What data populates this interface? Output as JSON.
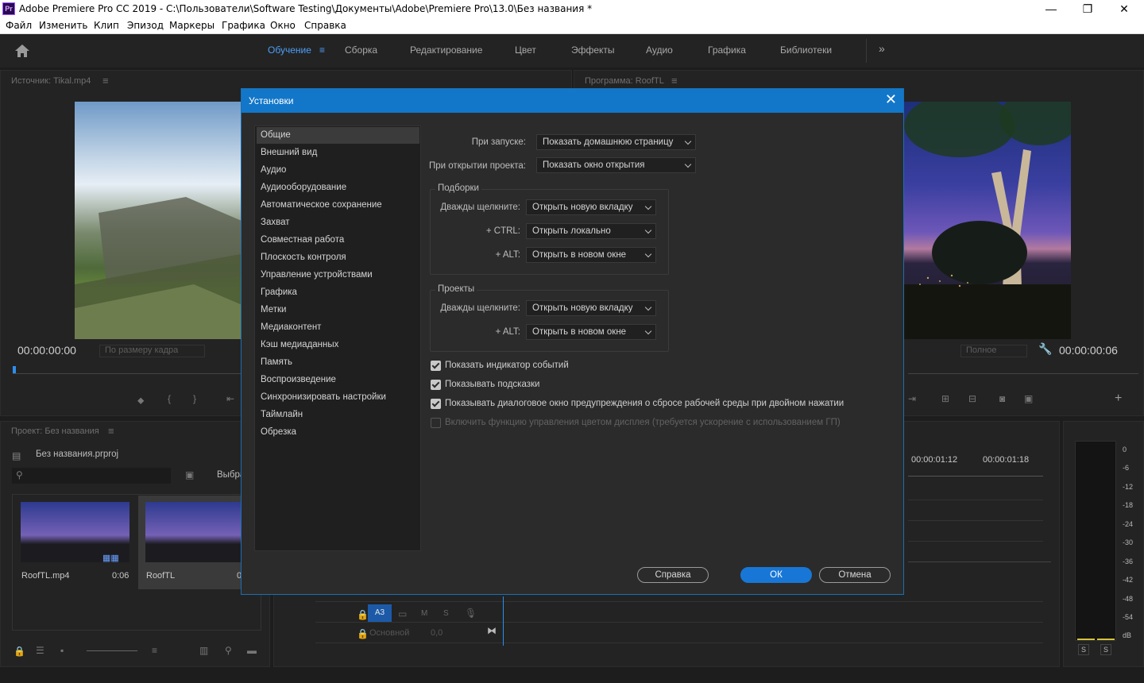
{
  "window": {
    "title": "Adobe Premiere Pro CC 2019 - C:\\Пользователи\\Software Testing\\Документы\\Adobe\\Premiere Pro\\13.0\\Без названия *",
    "logo": "Pr",
    "minimize": "—",
    "maximize": "❐",
    "close": "✕"
  },
  "menu": [
    "Файл",
    "Изменить",
    "Клип",
    "Эпизод",
    "Маркеры",
    "Графика",
    "Окно",
    "Справка"
  ],
  "workspaces": {
    "tabs": [
      "Обучение",
      "Сборка",
      "Редактирование",
      "Цвет",
      "Эффекты",
      "Аудио",
      "Графика",
      "Библиотеки"
    ],
    "active": "Обучение",
    "more": "»"
  },
  "source_monitor": {
    "title": "Источник: Tikal.mp4",
    "timecode": "00:00:00:00",
    "fit": "По размеру кадра"
  },
  "program_monitor": {
    "title": "Программа: RoofTL",
    "timecode": "00:00:00:06",
    "quality": "Полное"
  },
  "project_panel": {
    "title": "Проект: Без названия",
    "project_file": "Без названия.prproj",
    "select_label": "Выбра",
    "items": [
      {
        "name": "RoofTL.mp4",
        "duration": "0:06"
      },
      {
        "name": "RoofTL",
        "duration": "0"
      }
    ]
  },
  "timeline": {
    "time1": "00:00:01:12",
    "time2": "00:00:01:18",
    "track_a3": "A3",
    "track_m": "M",
    "track_s": "S",
    "master_label": "Основной",
    "master_value": "0,0"
  },
  "audio_meter": {
    "scale": [
      "0",
      "-6",
      "-12",
      "-18",
      "-24",
      "-30",
      "-36",
      "-42",
      "-48",
      "-54",
      "dB"
    ],
    "solo_left": "S",
    "solo_right": "S"
  },
  "dialog": {
    "title": "Установки",
    "close": "✕",
    "categories": [
      "Общие",
      "Внешний вид",
      "Аудио",
      "Аудиооборудование",
      "Автоматическое сохранение",
      "Захват",
      "Совместная работа",
      "Плоскость контроля",
      "Управление устройствами",
      "Графика",
      "Метки",
      "Медиаконтент",
      "Кэш медиаданных",
      "Память",
      "Воспроизведение",
      "Синхронизировать настройки",
      "Таймлайн",
      "Обрезка"
    ],
    "selected_category": "Общие",
    "startup_label": "При запуске:",
    "startup_value": "Показать домашнюю страницу",
    "open_project_label": "При открытии проекта:",
    "open_project_value": "Показать окно открытия",
    "bins": {
      "title": "Подборки",
      "double_click_label": "Дважды щелкните:",
      "double_click_value": "Открыть новую вкладку",
      "ctrl_label": "+ CTRL:",
      "ctrl_value": "Открыть локально",
      "alt_label": "+ ALT:",
      "alt_value": "Открыть в новом окне"
    },
    "projects": {
      "title": "Проекты",
      "double_click_label": "Дважды щелкните:",
      "double_click_value": "Открыть новую вкладку",
      "alt_label": "+ ALT:",
      "alt_value": "Открыть в новом окне"
    },
    "checkboxes": [
      {
        "label": "Показать индикатор событий",
        "checked": true,
        "enabled": true
      },
      {
        "label": "Показывать подсказки",
        "checked": true,
        "enabled": true
      },
      {
        "label": "Показывать диалоговое окно предупреждения о сбросе рабочей среды при двойном нажатии",
        "checked": true,
        "enabled": true
      },
      {
        "label": "Включить функцию управления цветом дисплея  (требуется ускорение с использованием ГП)",
        "checked": false,
        "enabled": false
      }
    ],
    "help_button": "Справка",
    "ok_button": "ОК",
    "cancel_button": "Отмена"
  },
  "colors": {
    "accent": "#1877d6",
    "title_bar": "#1277c9",
    "active_tab": "#4d9ef5"
  }
}
